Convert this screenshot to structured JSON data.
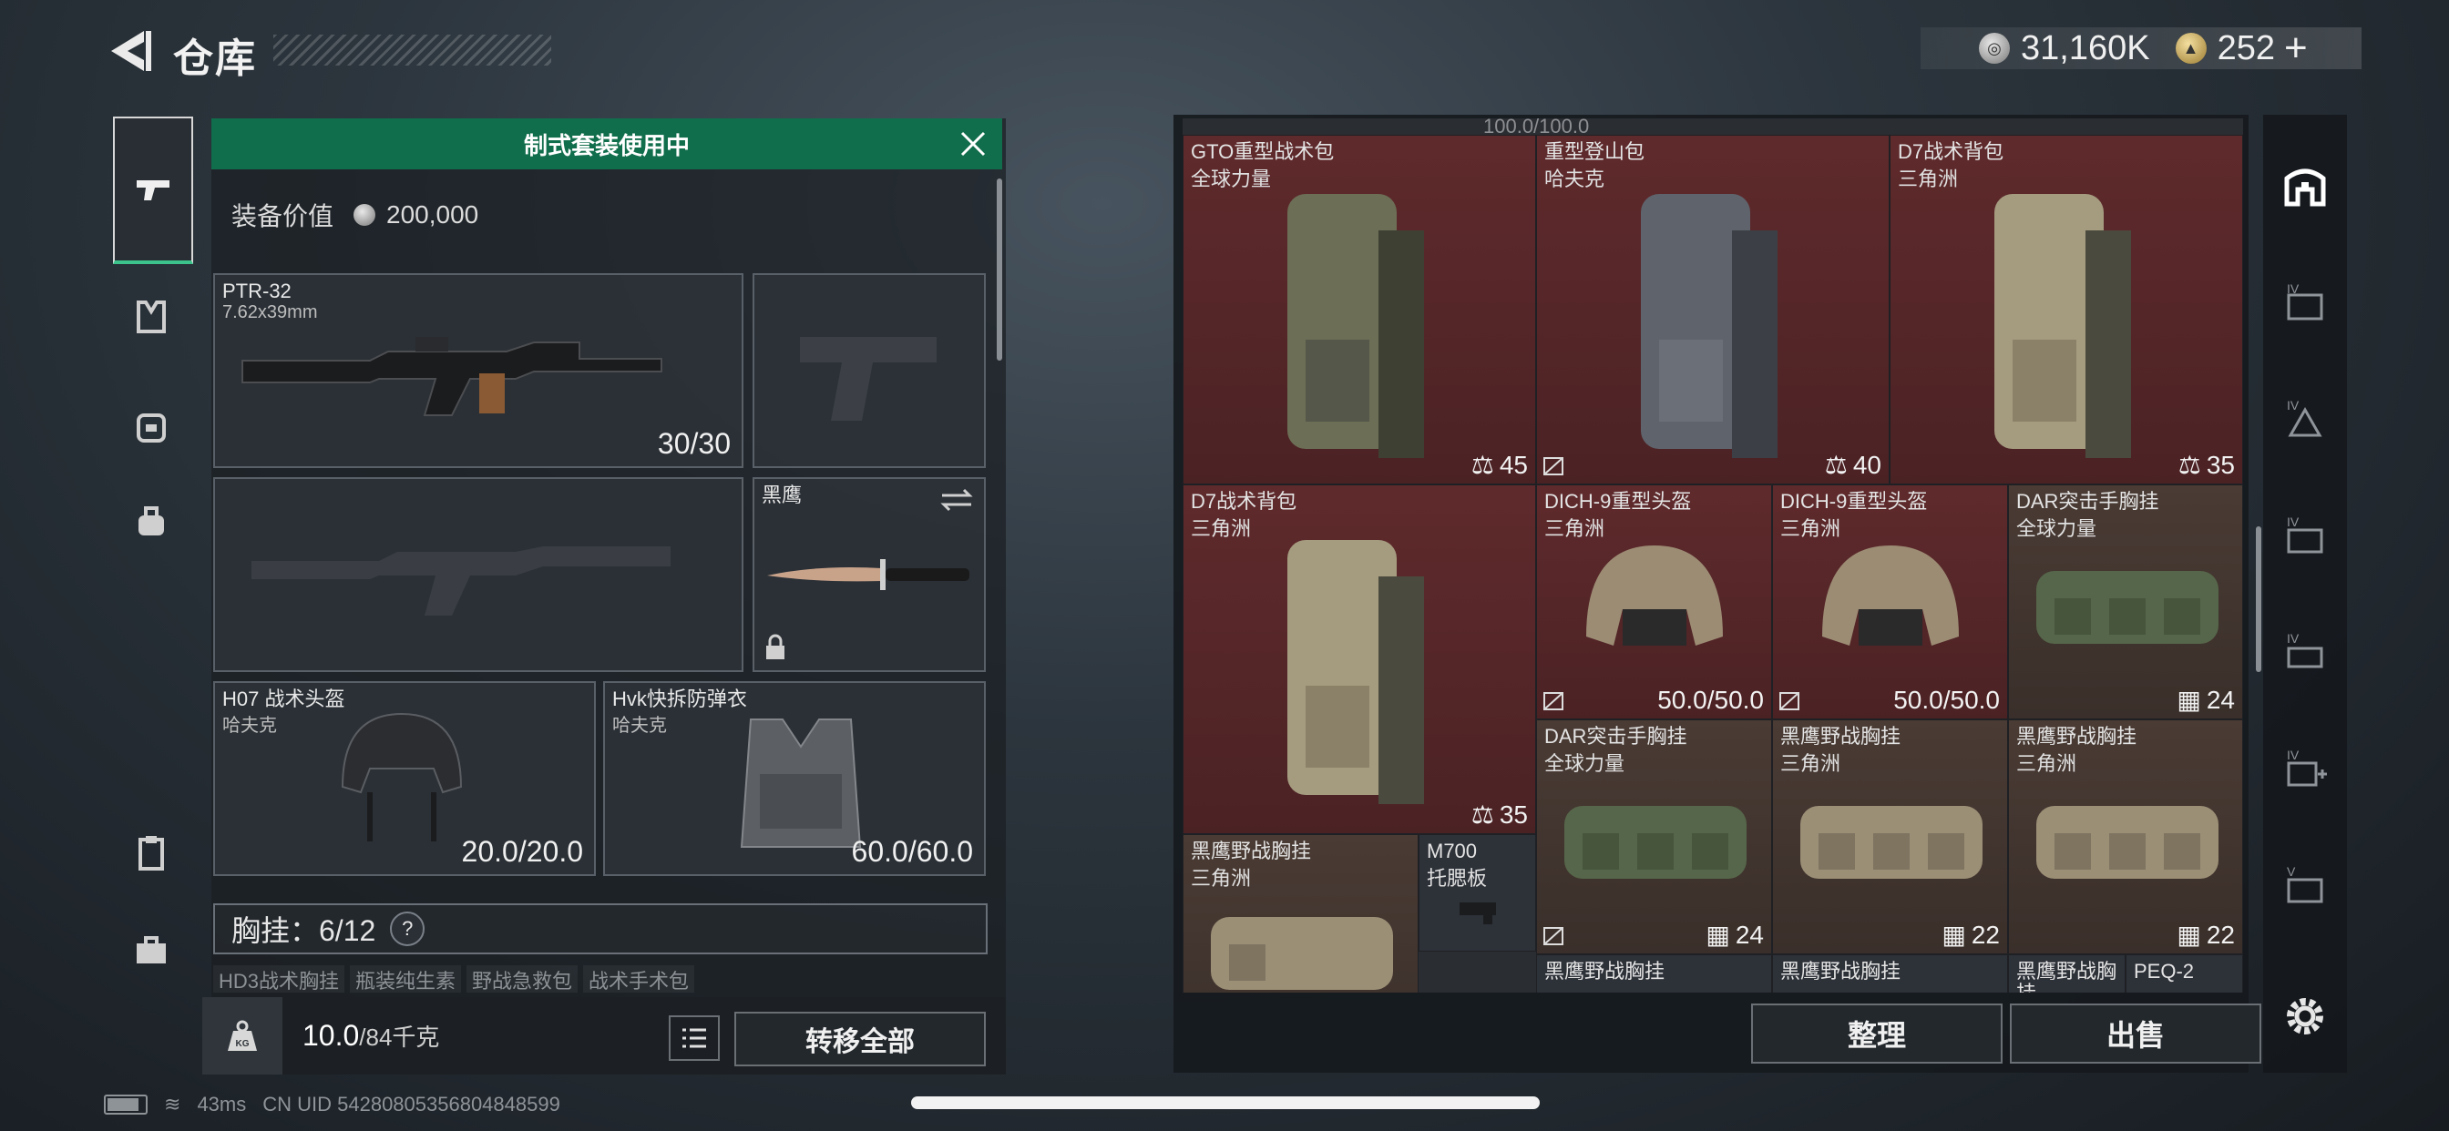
{
  "header": {
    "title": "仓库",
    "currency_silver": "31,160K",
    "currency_gold": "252",
    "plus": "+"
  },
  "loadout": {
    "banner": "制式套装使用中",
    "equip_value_label": "装备价值",
    "equip_value": "200,000",
    "primary": {
      "name": "PTR-32",
      "caliber": "7.62x39mm",
      "ammo": "30/30"
    },
    "melee": {
      "name": "黑鹰"
    },
    "helmet": {
      "name": "H07 战术头盔",
      "map": "哈夫克",
      "durability": "20.0/20.0"
    },
    "armor": {
      "name": "Hvk快拆防弹衣",
      "map": "哈夫克",
      "durability": "60.0/60.0"
    },
    "chest_rig": {
      "label": "胸挂：6/12",
      "help": "?"
    },
    "chest_items": [
      "HD3战术胸挂",
      "瓶装纯生素",
      "野战急救包",
      "战术手术包"
    ],
    "weight": "10.0",
    "weight_max": "/84千克",
    "kg_label": "KG",
    "transfer_all": "转移全部"
  },
  "stash": {
    "top_fragment": "100.0/100.0",
    "items": [
      {
        "name": "GTO重型战术包",
        "sub": "全球力量",
        "count": "45"
      },
      {
        "name": "重型登山包",
        "sub": "哈夫克",
        "count": "40"
      },
      {
        "name": "D7战术背包",
        "sub": "三角洲",
        "count": "35"
      },
      {
        "name": "D7战术背包",
        "sub": "三角洲",
        "count": "35"
      },
      {
        "name": "DICH-9重型头盔",
        "sub": "三角洲",
        "count": "50.0/50.0"
      },
      {
        "name": "DICH-9重型头盔",
        "sub": "三角洲",
        "count": "50.0/50.0"
      },
      {
        "name": "DAR突击手胸挂",
        "sub": "全球力量",
        "count": "24"
      },
      {
        "name": "DAR突击手胸挂",
        "sub": "全球力量",
        "count": "24"
      },
      {
        "name": "黑鹰野战胸挂",
        "sub": "三角洲",
        "count": "22"
      },
      {
        "name": "黑鹰野战胸挂",
        "sub": "三角洲",
        "count": "22"
      },
      {
        "name": "黑鹰野战胸挂",
        "sub": "三角洲",
        "count": ""
      },
      {
        "name": "M700",
        "sub": "托腮板",
        "count": ""
      },
      {
        "name": "黑鹰野战胸挂",
        "sub": "",
        "count": ""
      },
      {
        "name": "黑鹰野战胸挂",
        "sub": "",
        "count": ""
      },
      {
        "name": "黑鹰野战胸挂",
        "sub": "",
        "count": ""
      },
      {
        "name": "PEQ-2",
        "sub": "",
        "count": ""
      }
    ],
    "sort_button": "整理",
    "sell_button": "出售"
  },
  "right_nav": [
    "IV",
    "IV",
    "IV",
    "IV",
    "IV",
    "V"
  ],
  "status_bar": {
    "ping": "43ms",
    "uid": "CN UID 5428080535680484859​9"
  },
  "colors": {
    "accent_green": "#116e4c",
    "rare_red": "#5f2a2c",
    "epic_brown": "#4a3b34"
  }
}
